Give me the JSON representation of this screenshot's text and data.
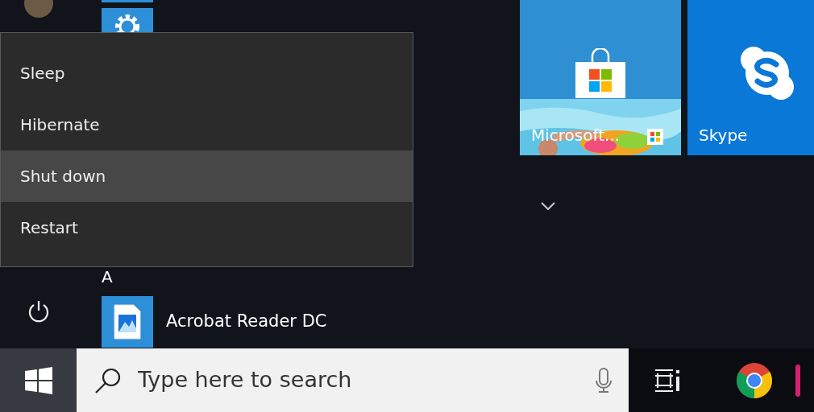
{
  "start_menu": {
    "section_header": "A",
    "apps_a": [
      {
        "name": "Acrobat Reader DC",
        "kind": "document"
      }
    ],
    "tiles": [
      {
        "label": "Microsoft...",
        "kind": "store"
      },
      {
        "label": "Skype",
        "kind": "skype"
      }
    ]
  },
  "power_menu": {
    "items": [
      {
        "label": "Sleep",
        "selected": false
      },
      {
        "label": "Hibernate",
        "selected": false
      },
      {
        "label": "Shut down",
        "selected": true
      },
      {
        "label": "Restart",
        "selected": false
      }
    ]
  },
  "taskbar": {
    "search": {
      "placeholder": "Type here to search"
    }
  }
}
